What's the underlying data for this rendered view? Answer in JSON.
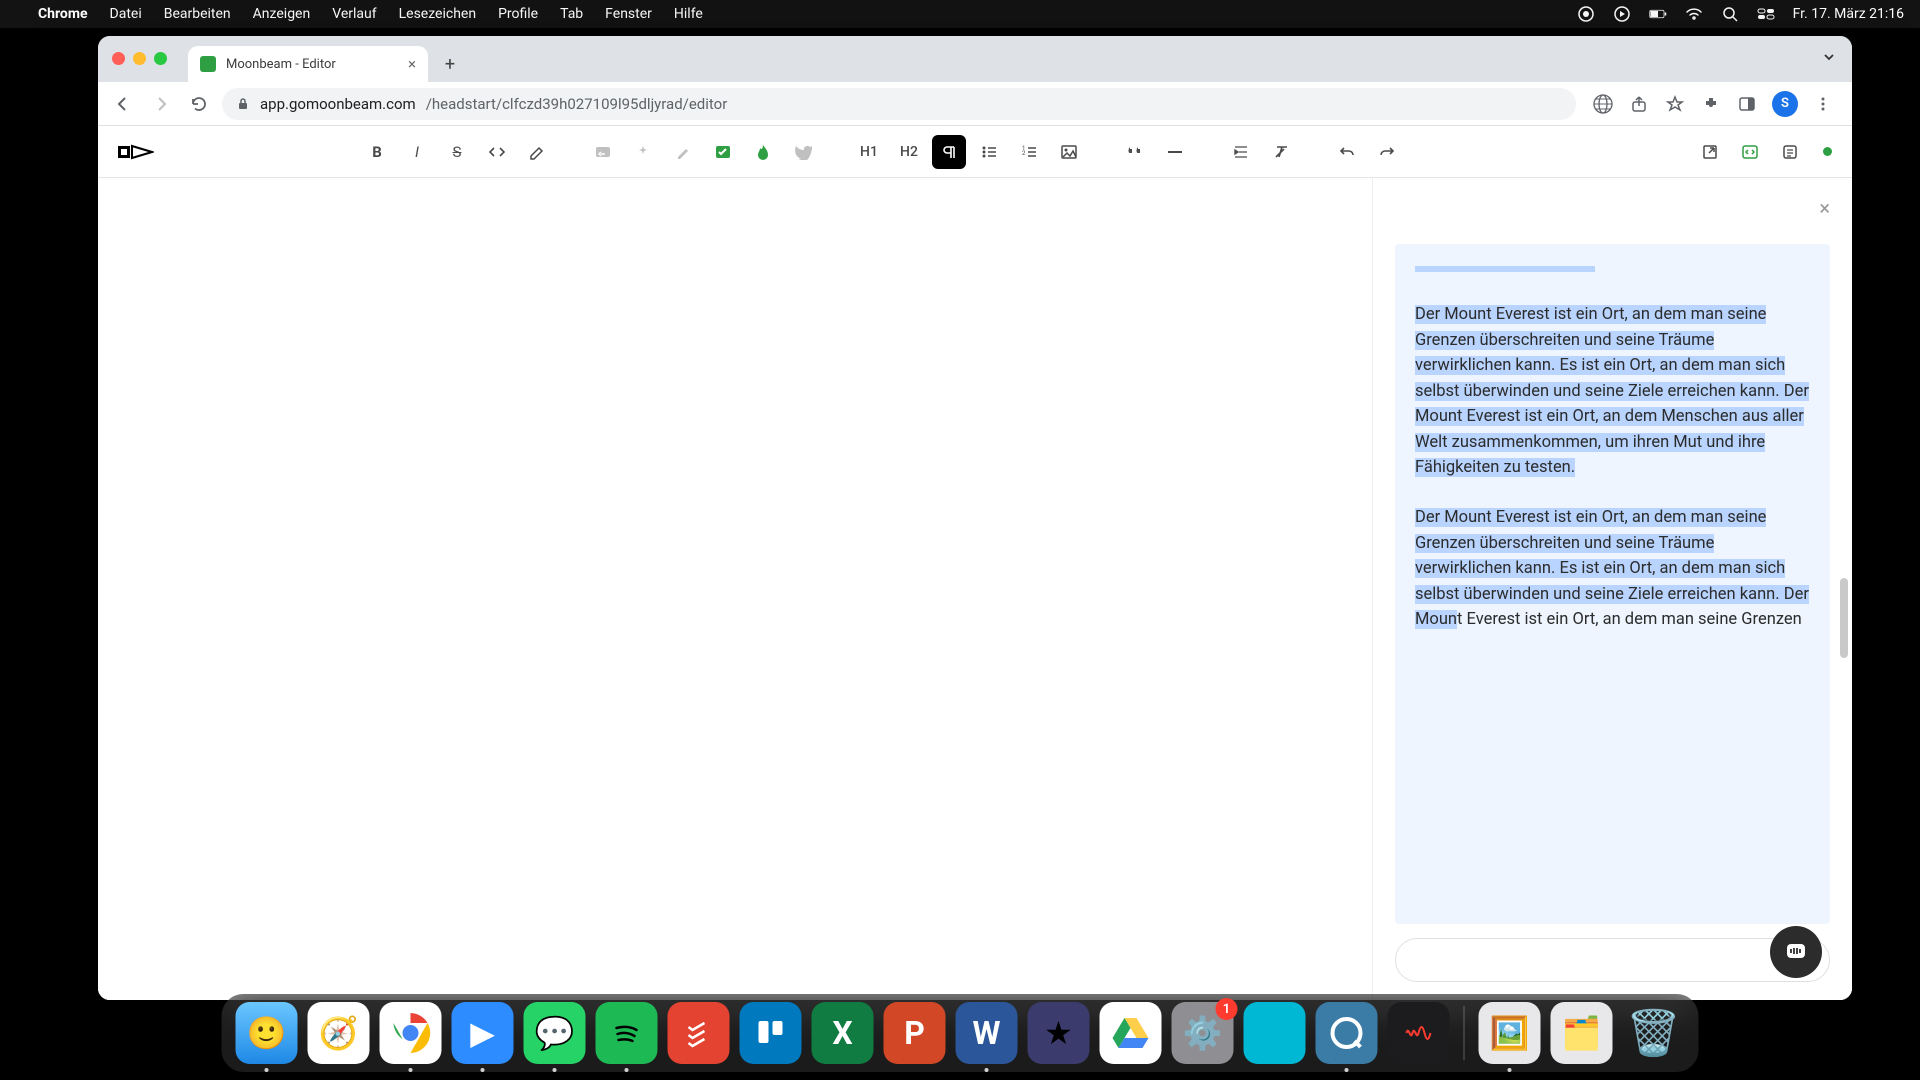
{
  "menubar": {
    "app": "Chrome",
    "items": [
      "Datei",
      "Bearbeiten",
      "Anzeigen",
      "Verlauf",
      "Lesezeichen",
      "Profile",
      "Tab",
      "Fenster",
      "Hilfe"
    ],
    "clock": "Fr. 17. März  21:16"
  },
  "browser": {
    "tab_title": "Moonbeam - Editor",
    "url_display_prefix": "app.gomoonbeam.com",
    "url_display_path": "/headstart/clfczd39h027109l95dljyrad/editor",
    "profile_initial": "S"
  },
  "toolbar": {
    "h1": "H1",
    "h2": "H2",
    "bold": "B",
    "italic": "I",
    "strike": "S"
  },
  "panel": {
    "para1": "Der Mount Everest ist ein Ort, an dem man seine Grenzen überschreiten und seine Träume verwirklichen kann. Es ist ein Ort, an dem man sich selbst überwinden und seine Ziele erreichen kann. Der Mount Everest ist ein Ort, an dem Menschen aus aller Welt zusammenkommen, um ihren Mut und ihre Fähigkeiten zu testen.",
    "para2_selected": "Der Mount Everest ist ein Ort, an dem man seine Grenzen überschreiten und seine Träume verwirklichen kann. Es ist ein Ort, an dem man sich selbst überwinden und seine Ziele erreichen kann. Der Moun",
    "para2_cursor": "t",
    "para2_rest": " Everest ist ein Ort, an dem man seine Grenzen"
  },
  "dock": {
    "settings_badge": "1"
  }
}
